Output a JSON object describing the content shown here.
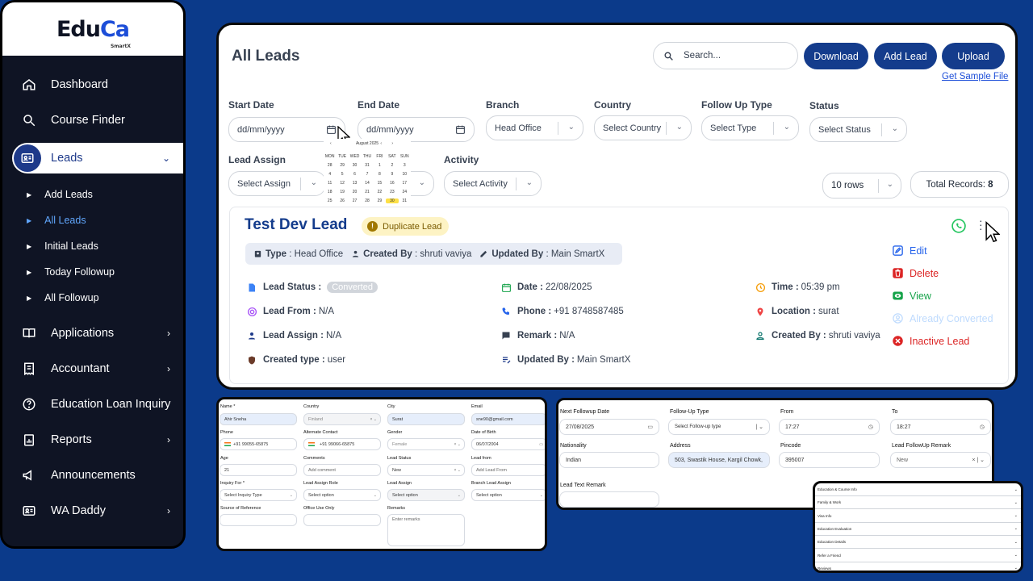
{
  "brand": {
    "logo_main": "Edu",
    "logo_accent": "Ca",
    "logo_sub": "SmartX"
  },
  "sidebar": {
    "items": [
      {
        "label": "Dashboard",
        "icon": "home-icon"
      },
      {
        "label": "Course Finder",
        "icon": "search-icon"
      },
      {
        "label": "Leads",
        "icon": "id-card-icon",
        "active": true
      },
      {
        "label": "Applications",
        "icon": "book-icon"
      },
      {
        "label": "Accountant",
        "icon": "receipt-icon"
      },
      {
        "label": "Education Loan Inquiry",
        "icon": "question-icon"
      },
      {
        "label": "Reports",
        "icon": "report-icon"
      },
      {
        "label": "Announcements",
        "icon": "megaphone-icon"
      },
      {
        "label": "WA Daddy",
        "icon": "id-card-icon"
      }
    ],
    "leads_sub": [
      "Add Leads",
      "All Leads",
      "Initial Leads",
      "Today Followup",
      "All Followup"
    ]
  },
  "header": {
    "title": "All Leads",
    "search_placeholder": "Search...",
    "download": "Download",
    "add_lead": "Add Lead",
    "upload": "Upload",
    "sample_link": "Get Sample File"
  },
  "filters": {
    "start_date": {
      "label": "Start Date",
      "placeholder": "dd/mm/yyyy"
    },
    "end_date": {
      "label": "End Date",
      "placeholder": "dd/mm/yyyy"
    },
    "branch": {
      "label": "Branch",
      "value": "Head Office"
    },
    "country": {
      "label": "Country",
      "value": "Select Country"
    },
    "follow_up_type": {
      "label": "Follow Up Type",
      "value": "Select Type"
    },
    "status": {
      "label": "Status",
      "value": "Select Status"
    },
    "lead_assign": {
      "label": "Lead Assign",
      "value": "Select Assign"
    },
    "activity": {
      "label": "Activity",
      "value": "Select Activity"
    },
    "rows": "10 rows",
    "total_label": "Total Records:",
    "total_value": "8"
  },
  "calendar": {
    "month": "August 2025",
    "nav_prev": "‹",
    "nav_next": "›",
    "days": [
      "MON",
      "TUE",
      "WED",
      "THU",
      "FRI",
      "SAT",
      "SUN"
    ],
    "dates": [
      "28",
      "29",
      "30",
      "31",
      "1",
      "2",
      "3",
      "4",
      "5",
      "6",
      "7",
      "8",
      "9",
      "10",
      "11",
      "12",
      "13",
      "14",
      "15",
      "16",
      "17",
      "18",
      "19",
      "20",
      "21",
      "22",
      "23",
      "24",
      "25",
      "26",
      "27",
      "28",
      "29",
      "30",
      "31"
    ],
    "today": "27"
  },
  "lead": {
    "name": "Test Dev Lead",
    "badge": "Duplicate Lead",
    "type_label": "Type",
    "type_value": "Head Office",
    "created_by_label": "Created By",
    "created_by_value": "shruti vaviya",
    "updated_by_label": "Updated By",
    "updated_by_value": "Main SmartX",
    "lead_status_label": "Lead Status :",
    "lead_status_value": "Converted",
    "date_label": "Date :",
    "date_value": "22/08/2025",
    "time_label": "Time :",
    "time_value": "05:39 pm",
    "lead_from_label": "Lead From :",
    "lead_from_value": "N/A",
    "phone_label": "Phone :",
    "phone_value": "+91 8748587485",
    "location_label": "Location :",
    "location_value": "surat",
    "lead_assign_label": "Lead Assign :",
    "lead_assign_value": "N/A",
    "remark_label": "Remark :",
    "remark_value": "N/A",
    "created_by2_label": "Created By :",
    "created_by2_value": "shruti vaviya",
    "created_type_label": "Created type :",
    "created_type_value": "user",
    "updated_by2_label": "Updated By :",
    "updated_by2_value": "Main SmartX",
    "actions": {
      "edit": "Edit",
      "delete": "Delete",
      "view": "View",
      "converted": "Already Converted",
      "inactive": "Inactive Lead"
    }
  },
  "form1": {
    "name": {
      "label": "Name *",
      "value": "Ahir Sneha"
    },
    "country": {
      "label": "Country",
      "value": "Finland"
    },
    "city": {
      "label": "City",
      "value": "Surat"
    },
    "email": {
      "label": "Email",
      "value": "sne90@gmail.com"
    },
    "phone": {
      "label": "Phone",
      "value": "+91 99055-65875"
    },
    "alt_contact": {
      "label": "Alternate Contact",
      "value": "+91 99066-65875"
    },
    "gender": {
      "label": "Gender",
      "value": "Female"
    },
    "dob": {
      "label": "Date of Birth",
      "value": "06/07/2004"
    },
    "age": {
      "label": "Age",
      "value": "21"
    },
    "comments": {
      "label": "Comments",
      "value": "Add comment"
    },
    "lead_status": {
      "label": "Lead Status",
      "value": "New"
    },
    "lead_from": {
      "label": "Lead from",
      "value": "Add Lead From"
    },
    "inquiry_for": {
      "label": "Inquiry For *",
      "value": "Select Inquiry Type"
    },
    "lead_assign_role": {
      "label": "Lead Assign Role",
      "value": "Select option"
    },
    "lead_assign": {
      "label": "Lead Assign",
      "value": "Select option"
    },
    "branch_lead_assign": {
      "label": "Branch Lead Assign",
      "value": "Select option"
    },
    "source_ref": {
      "label": "Source of Reference",
      "value": ""
    },
    "office_use": {
      "label": "Office Use Only",
      "value": ""
    },
    "remarks": {
      "label": "Remarks",
      "value": "Enter remarks"
    }
  },
  "form2": {
    "next_followup": {
      "label": "Next Followup Date",
      "value": "27/08/2025"
    },
    "followup_type": {
      "label": "Follow-Up Type",
      "value": "Select Follow-up type"
    },
    "from": {
      "label": "From",
      "value": "17:27"
    },
    "to": {
      "label": "To",
      "value": "18:27"
    },
    "nationality": {
      "label": "Nationality",
      "value": "Indian"
    },
    "address": {
      "label": "Address",
      "value": "503, Swastik House, Kargil Chowk,"
    },
    "pincode": {
      "label": "Pincode",
      "value": "395007"
    },
    "followup_remark": {
      "label": "Lead FollowUp Remark",
      "value": "New"
    },
    "text_remark": {
      "label": "Lead Text Remark",
      "value": ""
    }
  },
  "form3": {
    "sections": [
      "Education & Course Info",
      "Family & Work",
      "Visa Info",
      "Education Evaluation",
      "Education Details",
      "Refer a Friend",
      "Reviews"
    ]
  }
}
